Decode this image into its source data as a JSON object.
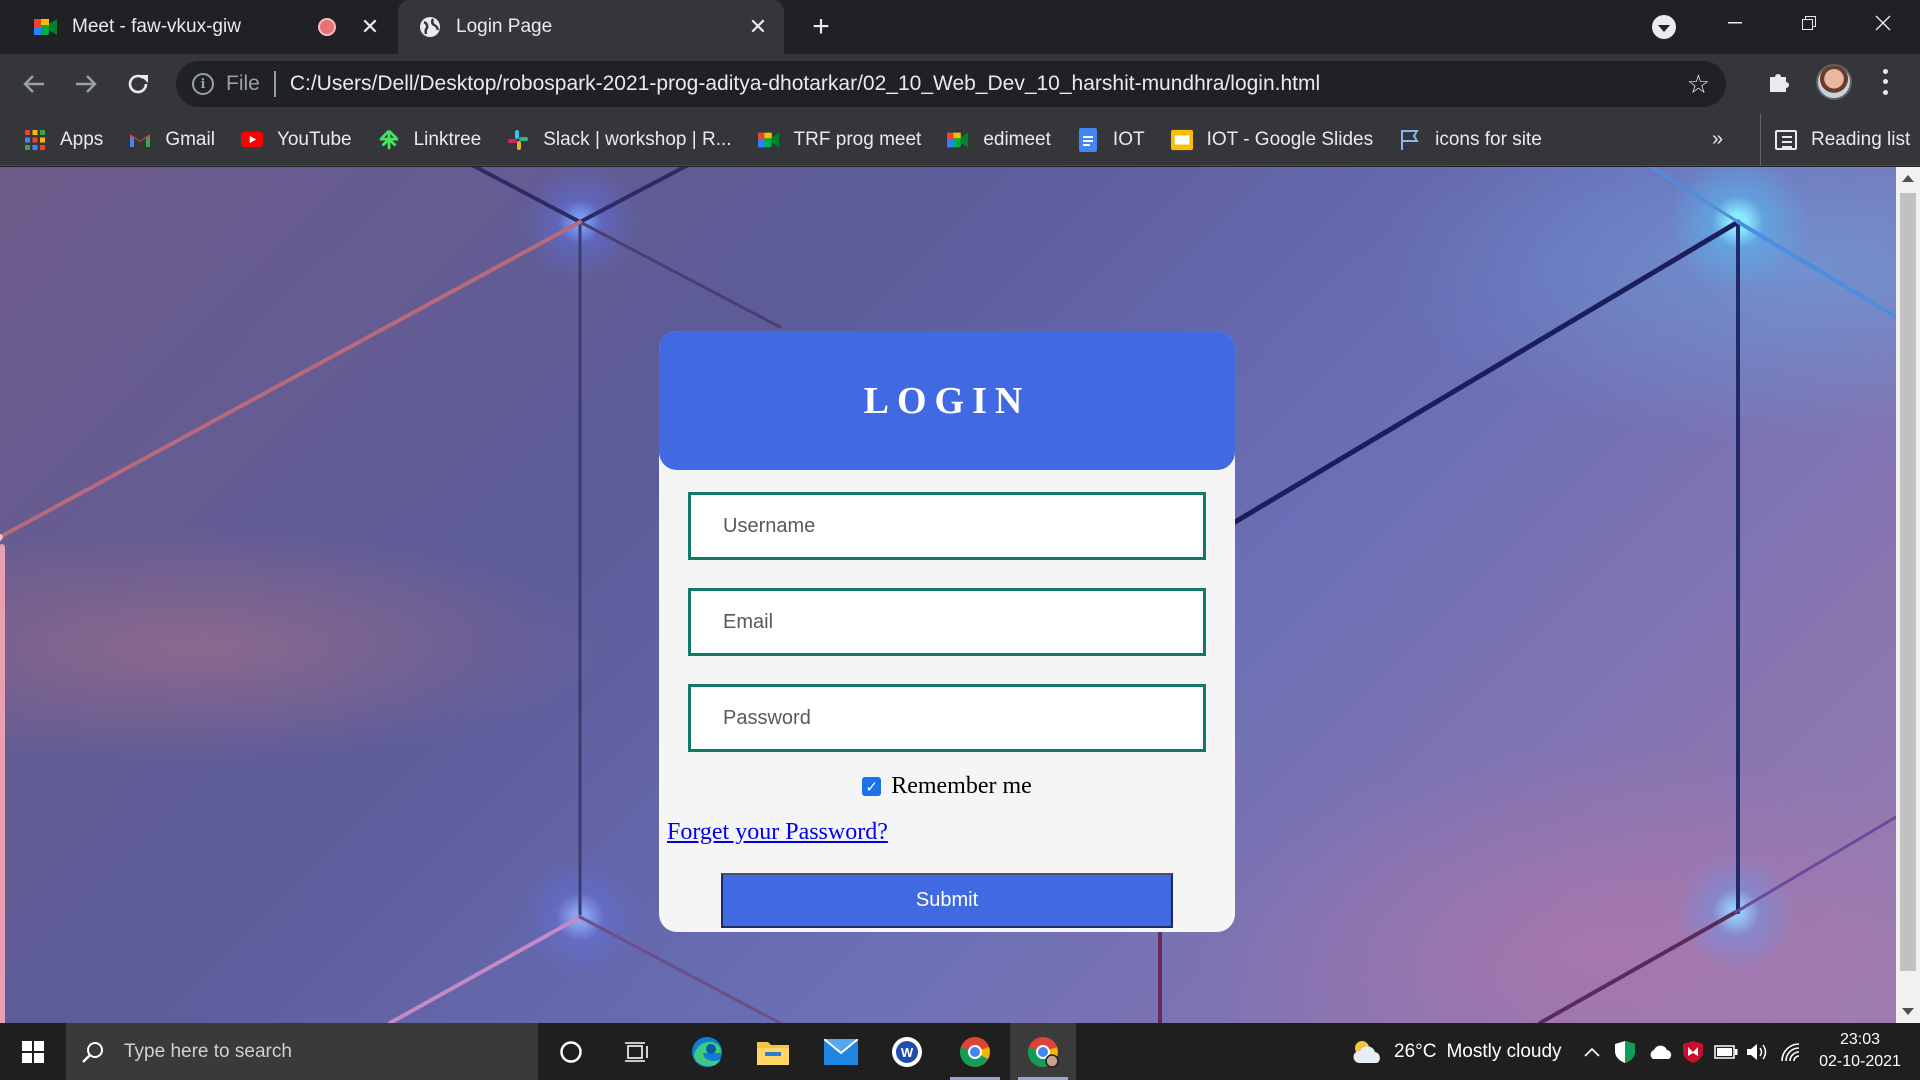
{
  "browser": {
    "tabs": [
      {
        "title": "Meet - faw-vkux-giw",
        "active": false,
        "recording": true
      },
      {
        "title": "Login Page",
        "active": true
      }
    ],
    "new_tab_symbol": "+",
    "address": {
      "scheme_label": "File",
      "url": "C:/Users/Dell/Desktop/robospark-2021-prog-aditya-dhotarkar/02_10_Web_Dev_10_harshit-mundhra/login.html"
    },
    "bookmarks": [
      {
        "label": "Apps",
        "icon": "apps-grid-icon"
      },
      {
        "label": "Gmail",
        "icon": "gmail-icon"
      },
      {
        "label": "YouTube",
        "icon": "youtube-icon"
      },
      {
        "label": "Linktree",
        "icon": "linktree-icon"
      },
      {
        "label": "Slack | workshop | R...",
        "icon": "slack-icon"
      },
      {
        "label": "TRF prog meet",
        "icon": "meet-icon"
      },
      {
        "label": "edimeet",
        "icon": "meet-icon"
      },
      {
        "label": "IOT",
        "icon": "docs-icon"
      },
      {
        "label": "IOT - Google Slides",
        "icon": "slides-icon"
      },
      {
        "label": "icons for site",
        "icon": "flag-icon"
      }
    ],
    "bookmarks_overflow": "»",
    "reading_list_label": "Reading list"
  },
  "login": {
    "title": "LOGIN",
    "username_placeholder": "Username",
    "email_placeholder": "Email",
    "password_placeholder": "Password",
    "remember_label": "Remember me",
    "remember_checked": true,
    "forgot_label": "Forget your Password?",
    "submit_label": "Submit"
  },
  "taskbar": {
    "search_placeholder": "Type here to search",
    "weather": {
      "temp": "26°C",
      "condition": "Mostly cloudy"
    },
    "time": "23:03",
    "date": "02-10-2021"
  },
  "colors": {
    "card_accent": "#4169e1",
    "input_border": "#0f7a6a",
    "link": "#0000ee",
    "browser_dark": "#202124",
    "browser_toolbar": "#35363a"
  }
}
